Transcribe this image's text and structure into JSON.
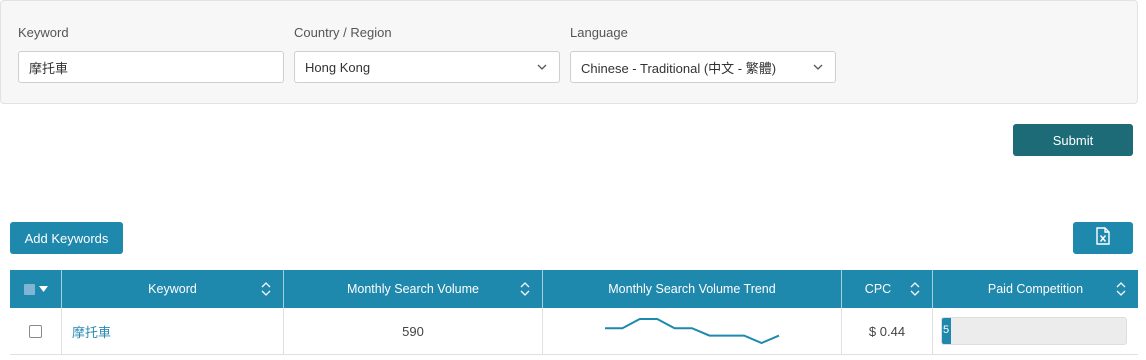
{
  "form": {
    "keyword_label": "Keyword",
    "keyword_value": "摩托車",
    "country_label": "Country / Region",
    "country_value": "Hong Kong",
    "language_label": "Language",
    "language_value": "Chinese - Traditional (中文 - 繁體)",
    "submit_label": "Submit"
  },
  "toolbar": {
    "add_keywords_label": "Add Keywords",
    "export_icon": "excel-export-icon"
  },
  "table": {
    "headers": [
      "Keyword",
      "Monthly Search Volume",
      "Monthly Search Volume Trend",
      "CPC",
      "Paid Competition"
    ],
    "rows": [
      {
        "keyword": "摩托車",
        "volume": "590",
        "trend": [
          5,
          5,
          10,
          10,
          5,
          5,
          1,
          1,
          1,
          -3,
          1
        ],
        "cpc": "$ 0.44",
        "competition_text": "5",
        "competition_fraction": 0.05
      }
    ]
  },
  "colors": {
    "header_bg": "#1e88ad",
    "submit_bg": "#1e6b78",
    "link": "#2a8ab3"
  }
}
